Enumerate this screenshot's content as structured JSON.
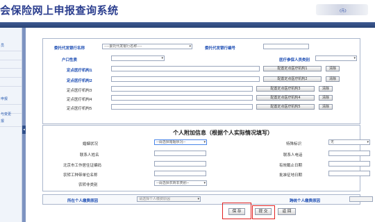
{
  "header": {
    "title": "会保险网上申报查询系统"
  },
  "sidebar": {
    "items": [
      "",
      "员",
      "",
      "",
      "",
      "",
      "",
      "申报",
      "",
      "",
      "",
      "与变更",
      "报",
      ""
    ]
  },
  "form": {
    "unit_note": "(元)",
    "bank_label": "委托代发银行名称",
    "bank_select": "----委托代发银行名称----",
    "bank_code_label": "委托代发银行编号",
    "hukou_label": "户口性质",
    "category_label": "医疗参保人员类别",
    "hosp_rows": [
      {
        "label": "定点医疗机构1",
        "btn": "配置定点医疗机构1",
        "clear": "清除"
      },
      {
        "label": "定点医疗机构2",
        "btn": "配置定点医疗机构2",
        "clear": "清除"
      },
      {
        "label": "定点医疗机构3",
        "btn": "配置定点医疗机构3",
        "clear": "清除"
      },
      {
        "label": "定点医疗机构4",
        "btn": "配置定点医疗机构4",
        "clear": "清除"
      },
      {
        "label": "定点医疗机构5",
        "btn": "配置定点医疗机构5",
        "clear": "清除"
      }
    ]
  },
  "extra": {
    "title": "个人附加信息（根据个人实际情况填写）",
    "marital_label": "婚姻状况",
    "marital_select": "--请选择婚姻状况--",
    "special_label": "特殊标识",
    "special_value": "无",
    "contact_name_label": "联系人姓名",
    "contact_phone_label": "联系人电话",
    "residence_label": "北京市工作居住证编码",
    "valid_date_label": "有效截止日期",
    "farmer_org_label": "农转工种带单位名称",
    "approve_date_label": "批准征地日期",
    "farmer_type_label": "农转非类别",
    "farmer_type_select": "--请选择农转非类别--"
  },
  "footer_row": {
    "reason_label": "所在个人缴费原因",
    "reason_select": "请选择个人缴费原因",
    "right_label": "跨统个人缴费原因"
  },
  "actions": {
    "save": "保 存",
    "submit": "提 交",
    "back": "返 回"
  }
}
